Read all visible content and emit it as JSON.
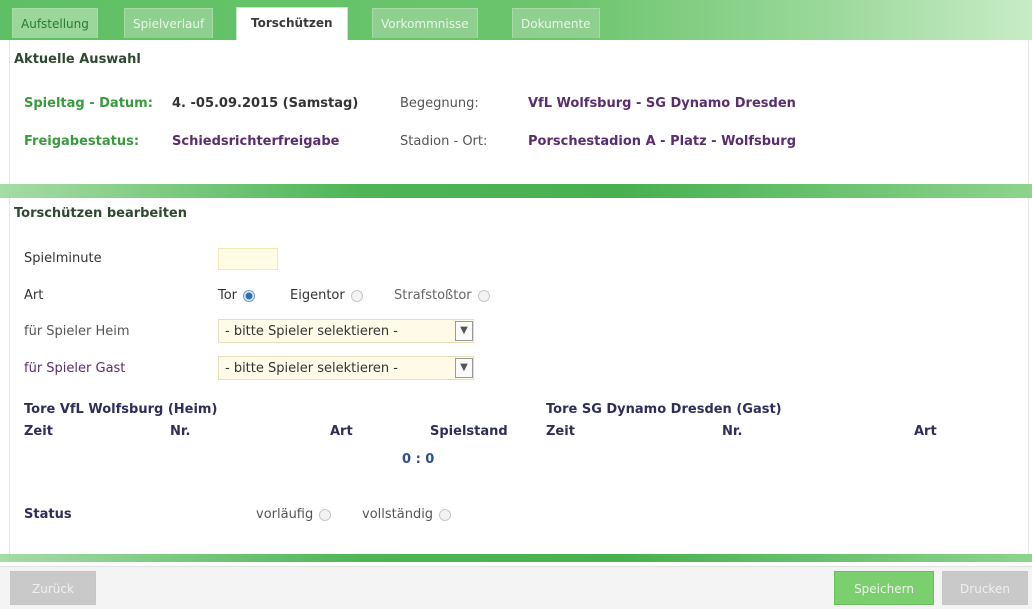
{
  "tabs": [
    {
      "label": "Aufstellung"
    },
    {
      "label": "Spielverlauf"
    },
    {
      "label": "Torschützen"
    },
    {
      "label": "Vorkommnisse"
    },
    {
      "label": "Dokumente"
    }
  ],
  "selection": {
    "title": "Aktuelle Auswahl",
    "matchday_label": "Spieltag - Datum:",
    "matchday_value": "4. -05.09.2015 (Samstag)",
    "fixture_label": "Begegnung:",
    "fixture_value": "VfL Wolfsburg - SG Dynamo Dresden",
    "release_label": "Freigabestatus:",
    "release_value": "Schiedsrichterfreigabe",
    "stadium_label": "Stadion - Ort:",
    "stadium_value": "Porschestadion A - Platz - Wolfsburg"
  },
  "editor": {
    "title": "Torschützen bearbeiten",
    "minute_label": "Spielminute",
    "minute_value": "",
    "type_label": "Art",
    "type_options": [
      "Tor",
      "Eigentor",
      "Strafstoßtor"
    ],
    "type_selected": "Tor",
    "home_player_label": "für Spieler Heim",
    "home_player_value": "- bitte Spieler selektieren -",
    "guest_player_label": "für Spieler Gast",
    "guest_player_value": "- bitte Spieler selektieren -"
  },
  "goals": {
    "home_title": "Tore VfL Wolfsburg (Heim)",
    "guest_title": "Tore SG Dynamo Dresden (Gast)",
    "col_time": "Zeit",
    "col_number": "Nr.",
    "col_type": "Art",
    "col_score": "Spielstand",
    "score": "0 : 0"
  },
  "status": {
    "label": "Status",
    "options": [
      "vorläufig",
      "vollständig"
    ],
    "selected": "vorläufig"
  },
  "footer": {
    "back": "Zurück",
    "save": "Speichern",
    "print": "Drucken"
  },
  "colors": {
    "brand_green": "#5fbf64",
    "save_green": "#7ccf6e",
    "label_green": "#3a9a3e",
    "value_purple": "#5a2d6e"
  }
}
